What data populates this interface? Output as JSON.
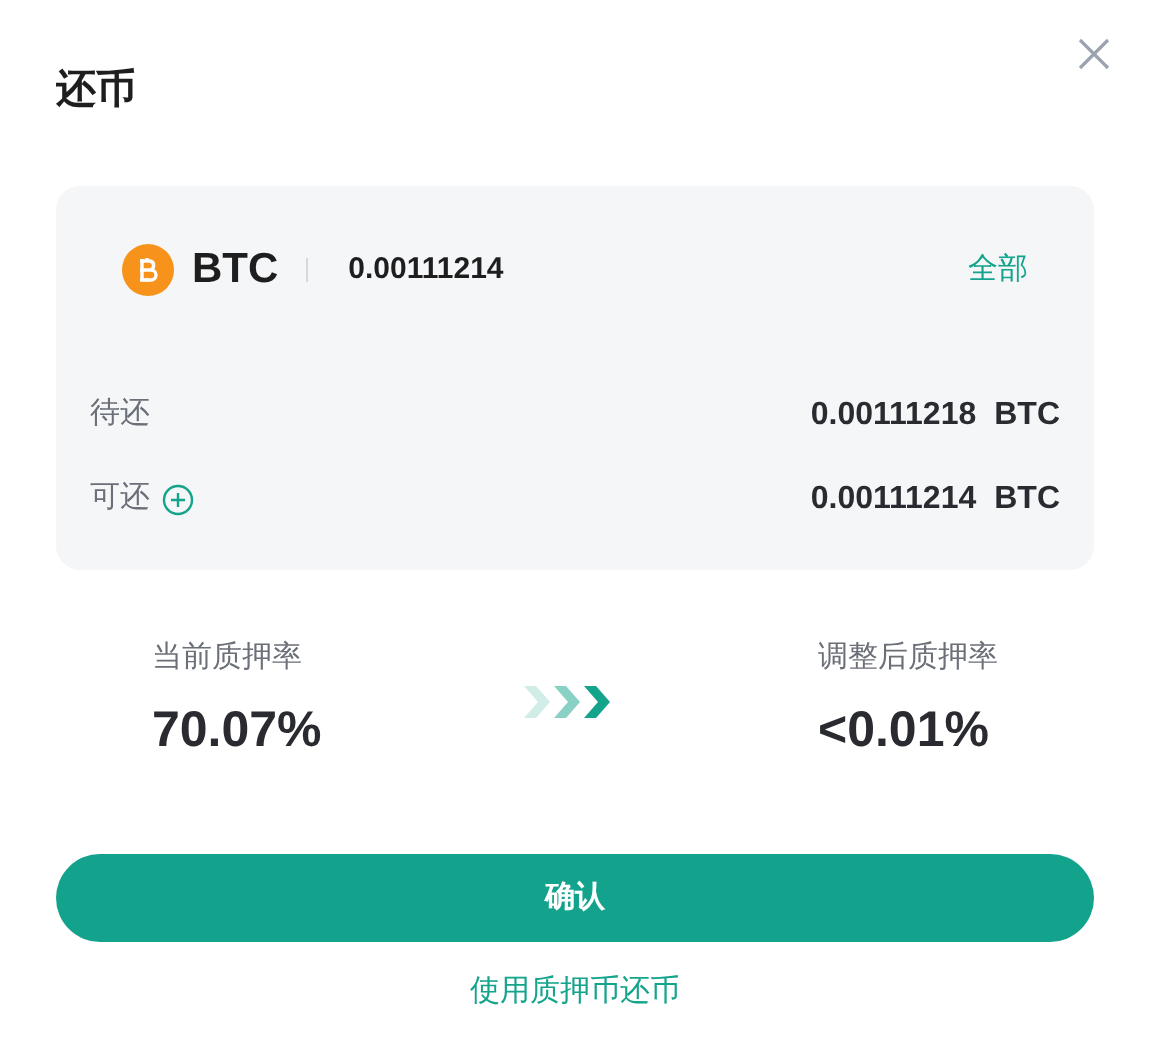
{
  "dialog": {
    "title": "还币"
  },
  "repay": {
    "coin": "BTC",
    "amount": "0.00111214",
    "max_link": "全部"
  },
  "rows": [
    {
      "label": "待还",
      "value": "0.00111218",
      "unit": "BTC",
      "add": false
    },
    {
      "label": "可还",
      "value": "0.00111214",
      "unit": "BTC",
      "add": true
    }
  ],
  "rates": {
    "current_label": "当前质押率",
    "current_value": "70.07%",
    "after_label": "调整后质押率",
    "after_value": "<0.01%"
  },
  "confirm_button": "确认",
  "collateral_link": "使用质押币还币"
}
